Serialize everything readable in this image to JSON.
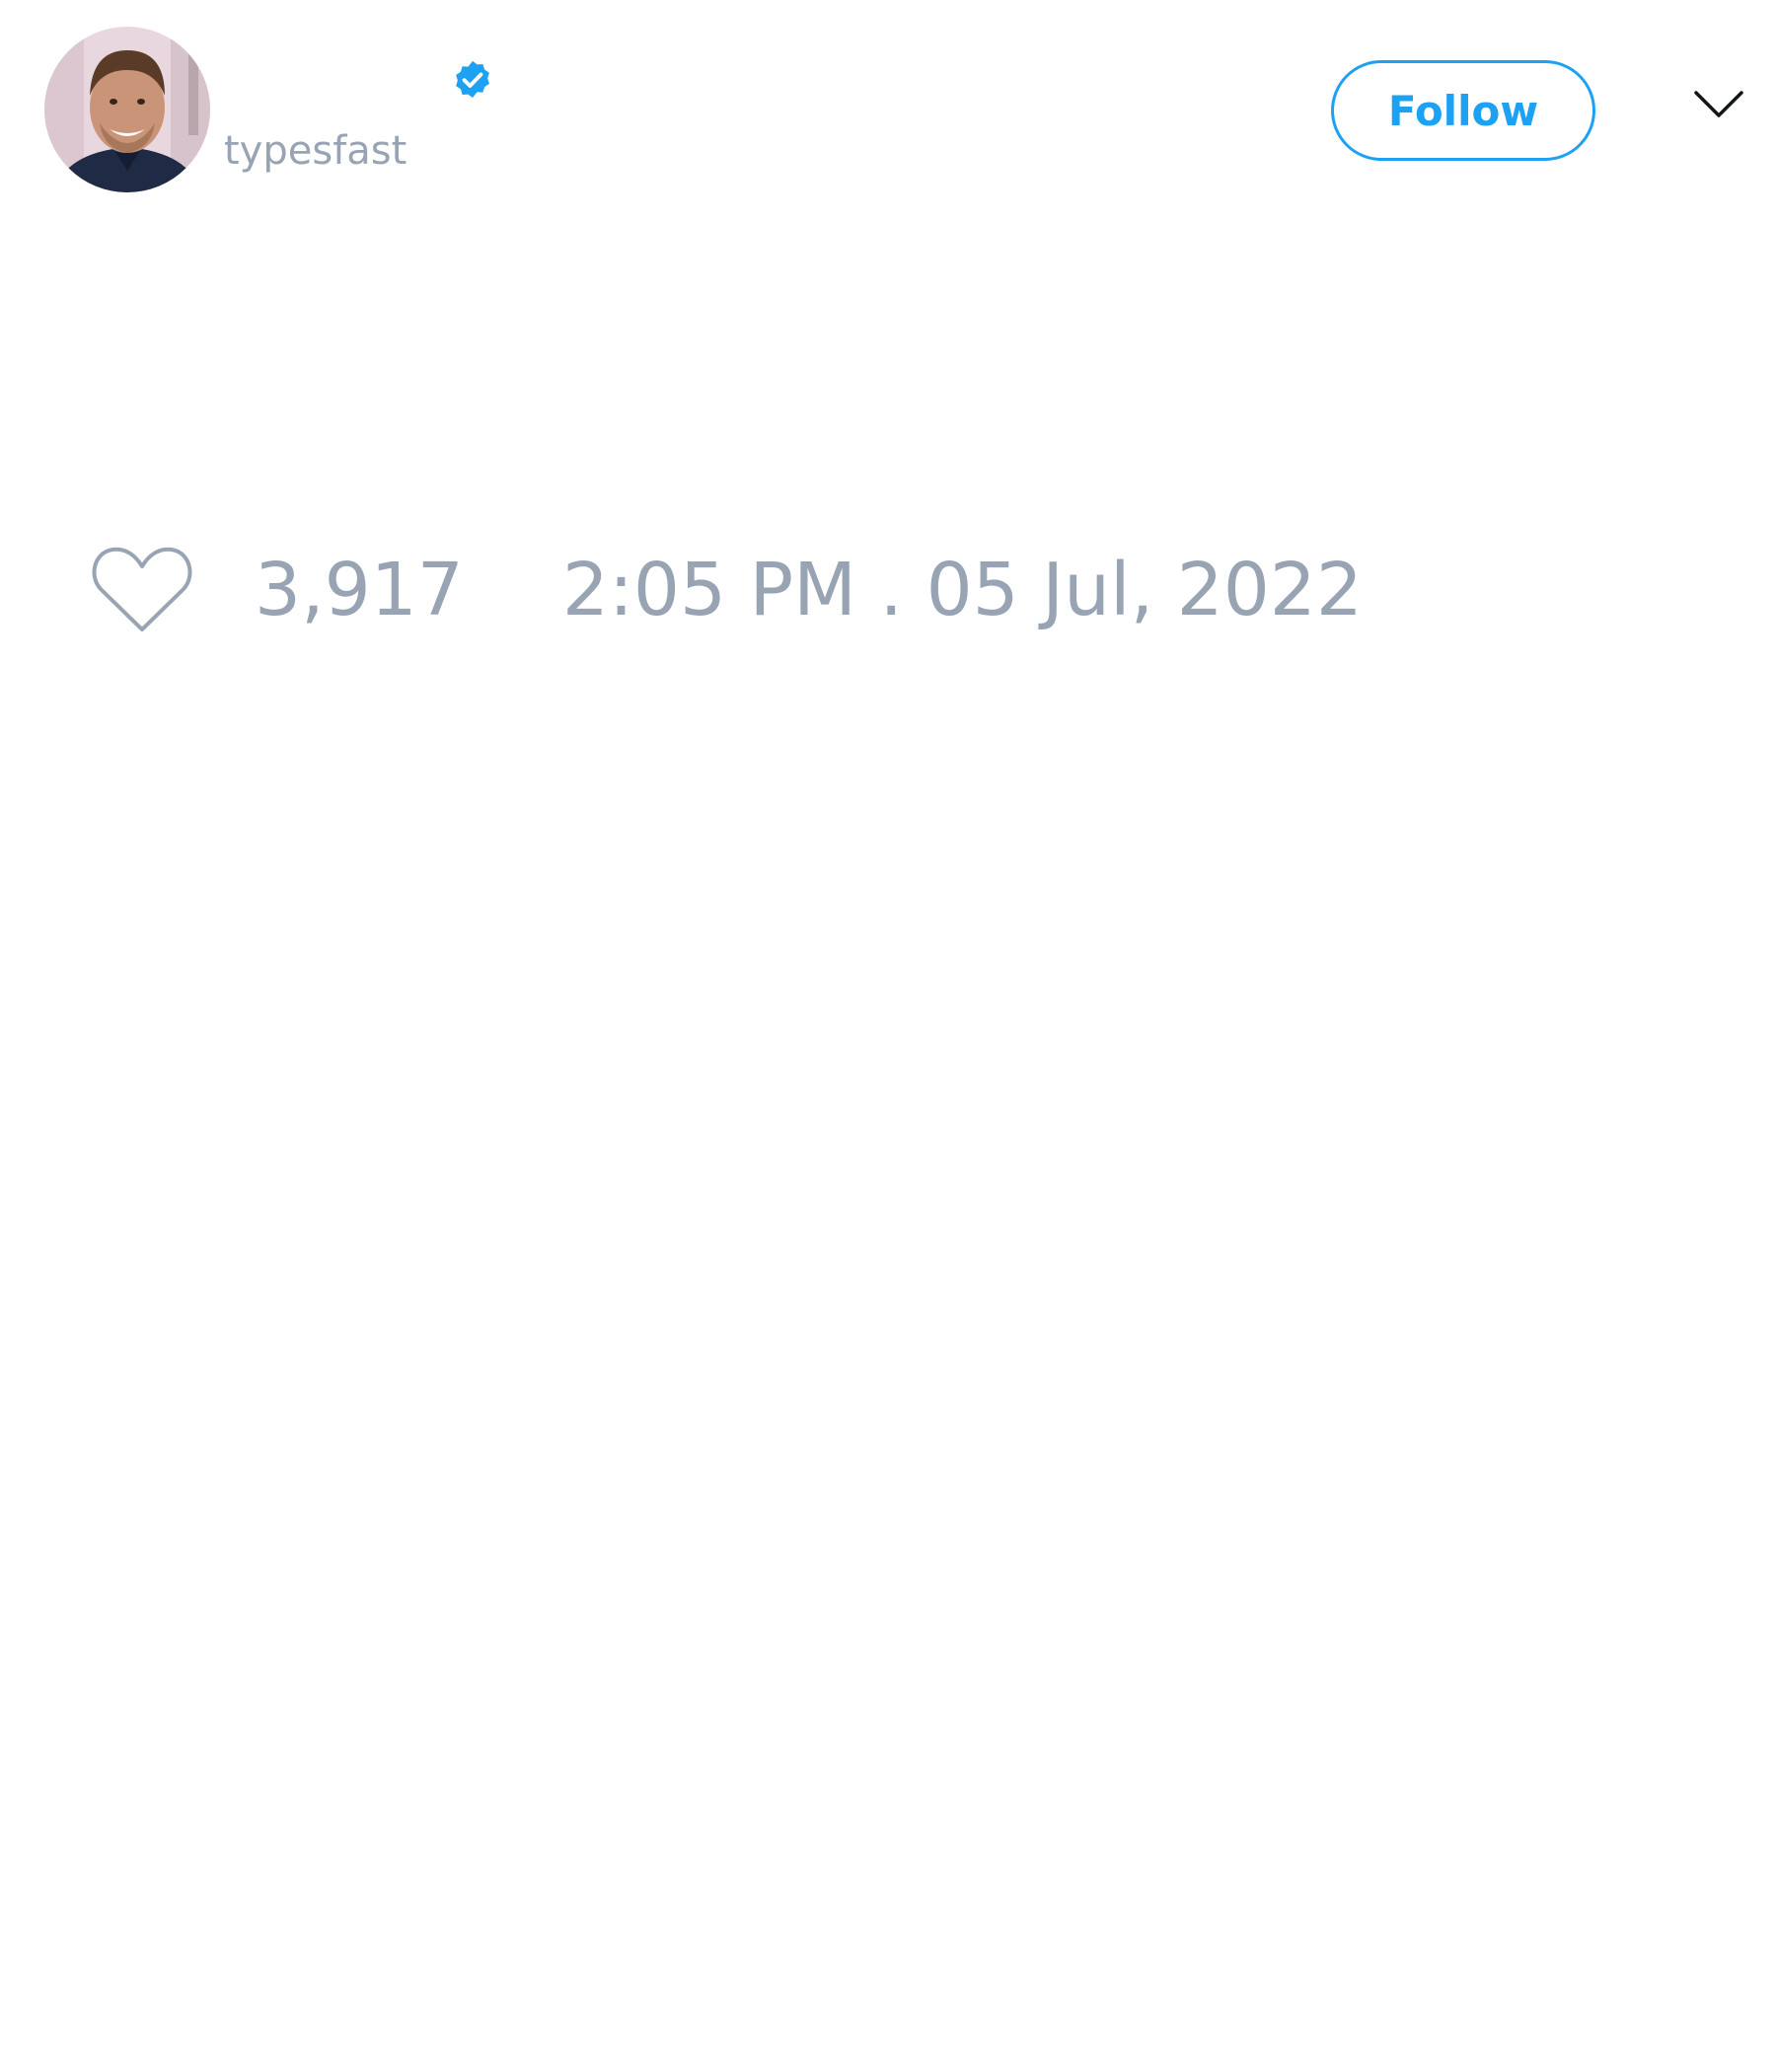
{
  "tweet": {
    "author": {
      "handle": "typesfast",
      "verified": true,
      "verified_icon": "verified-badge-icon"
    },
    "follow_label": "Follow",
    "menu_icon": "chevron-down-icon",
    "like_icon": "heart-icon",
    "like_count": "3,917",
    "timestamp": "2:05 PM . 05 Jul, 2022"
  },
  "colors": {
    "accent": "#1da1f2",
    "muted_text": "#98a4b3",
    "background": "#ffffff"
  }
}
